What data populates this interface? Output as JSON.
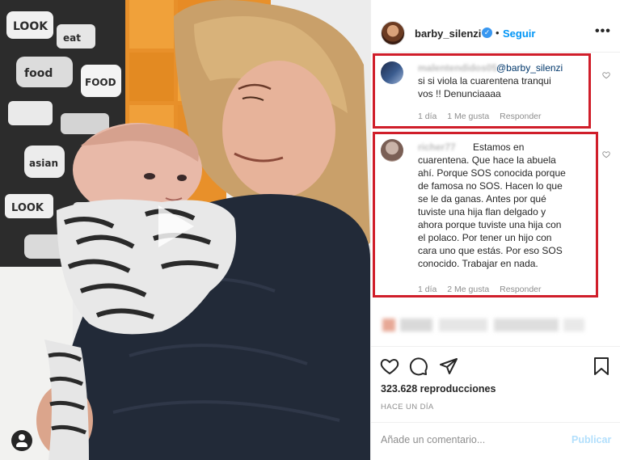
{
  "media": {
    "sticker_text": [
      "LOOK",
      "eat",
      "food",
      "FOOD",
      "asian",
      "LOOK"
    ]
  },
  "post_header": {
    "username": "barby_silenzi",
    "verified_mark": "✓",
    "separator": "•",
    "follow_label": "Seguir",
    "more_label": "•••"
  },
  "comments": [
    {
      "handle": "malentendidos05",
      "mention": "@barby_silenzi",
      "text_lines": [
        "si si viola la cuarentena tranqui",
        "vos !! Denunciaaaa"
      ],
      "time": "1 día",
      "likes": "1 Me gusta",
      "reply": "Responder"
    },
    {
      "handle": "richer77",
      "first_line": "Estamos en",
      "text_lines": [
        "cuarentena. Que hace la abuela",
        "ahí. Porque SOS conocida porque",
        "de famosa no SOS. Hacen lo que",
        "se le da ganas. Antes por qué",
        "tuviste una hija flan delgado y",
        "ahora porque tuviste una hija con",
        "el polaco. Por tener un hijo con",
        "cara uno que estás. Por eso SOS",
        "conocido. Trabajar en nada."
      ],
      "time": "1 día",
      "likes": "2 Me gusta",
      "reply": "Responder"
    }
  ],
  "actions": {
    "like": "heart-icon",
    "comment": "comment-icon",
    "share": "share-icon",
    "save": "bookmark-icon"
  },
  "stats": {
    "views": "323.628 reproducciones",
    "date": "HACE UN DÍA"
  },
  "add_comment": {
    "placeholder": "Añade un comentario...",
    "publish_label": "Publicar"
  },
  "colors": {
    "highlight": "#d01e2a",
    "link": "#0095f6",
    "publish_disabled": "#b2dffc"
  }
}
